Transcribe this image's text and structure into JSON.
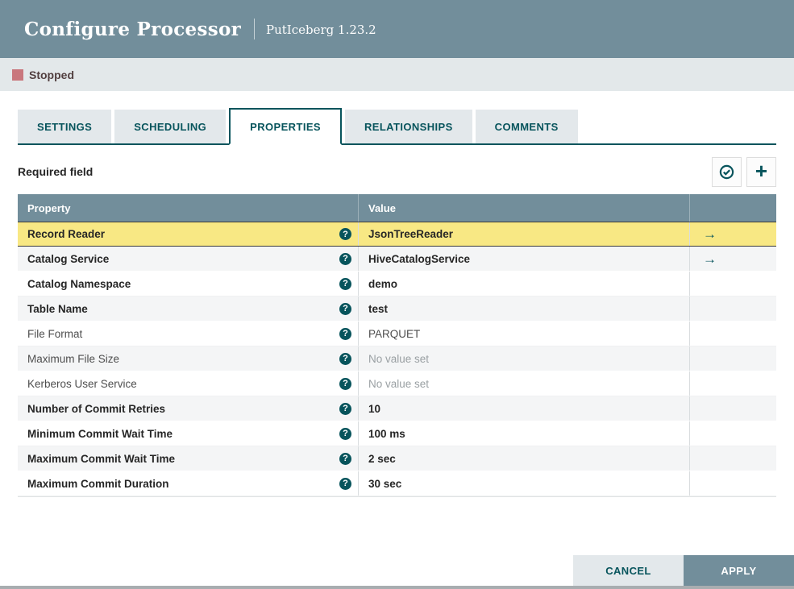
{
  "colors": {
    "header_bg": "#728e9b",
    "accent_teal": "#07545c",
    "selected_row_bg": "#f8e884",
    "alt_row_bg": "#f4f5f6",
    "status_bar_bg": "#e3e8ea",
    "status_stopped_swatch": "#c9777d"
  },
  "header": {
    "title": "Configure Processor",
    "subtitle": "PutIceberg 1.23.2"
  },
  "status": {
    "label": "Stopped"
  },
  "tabs": [
    {
      "label": "SETTINGS",
      "active": false
    },
    {
      "label": "SCHEDULING",
      "active": false
    },
    {
      "label": "PROPERTIES",
      "active": true
    },
    {
      "label": "RELATIONSHIPS",
      "active": false
    },
    {
      "label": "COMMENTS",
      "active": false
    }
  ],
  "toolbar": {
    "required_field_label": "Required field",
    "verify_icon": "check-circle-icon",
    "add_icon": "plus-icon"
  },
  "table": {
    "columns": [
      "Property",
      "Value"
    ],
    "rows": [
      {
        "property": "Record Reader",
        "value": "JsonTreeReader",
        "required": true,
        "value_set": true,
        "has_link": true,
        "selected": true
      },
      {
        "property": "Catalog Service",
        "value": "HiveCatalogService",
        "required": true,
        "value_set": true,
        "has_link": true,
        "selected": false
      },
      {
        "property": "Catalog Namespace",
        "value": "demo",
        "required": true,
        "value_set": true,
        "has_link": false,
        "selected": false
      },
      {
        "property": "Table Name",
        "value": "test",
        "required": true,
        "value_set": true,
        "has_link": false,
        "selected": false
      },
      {
        "property": "File Format",
        "value": "PARQUET",
        "required": false,
        "value_set": true,
        "has_link": false,
        "selected": false
      },
      {
        "property": "Maximum File Size",
        "value": "No value set",
        "required": false,
        "value_set": false,
        "has_link": false,
        "selected": false
      },
      {
        "property": "Kerberos User Service",
        "value": "No value set",
        "required": false,
        "value_set": false,
        "has_link": false,
        "selected": false
      },
      {
        "property": "Number of Commit Retries",
        "value": "10",
        "required": true,
        "value_set": true,
        "has_link": false,
        "selected": false
      },
      {
        "property": "Minimum Commit Wait Time",
        "value": "100 ms",
        "required": true,
        "value_set": true,
        "has_link": false,
        "selected": false
      },
      {
        "property": "Maximum Commit Wait Time",
        "value": "2 sec",
        "required": true,
        "value_set": true,
        "has_link": false,
        "selected": false
      },
      {
        "property": "Maximum Commit Duration",
        "value": "30 sec",
        "required": true,
        "value_set": true,
        "has_link": false,
        "selected": false
      }
    ]
  },
  "footer": {
    "cancel_label": "CANCEL",
    "apply_label": "APPLY"
  }
}
